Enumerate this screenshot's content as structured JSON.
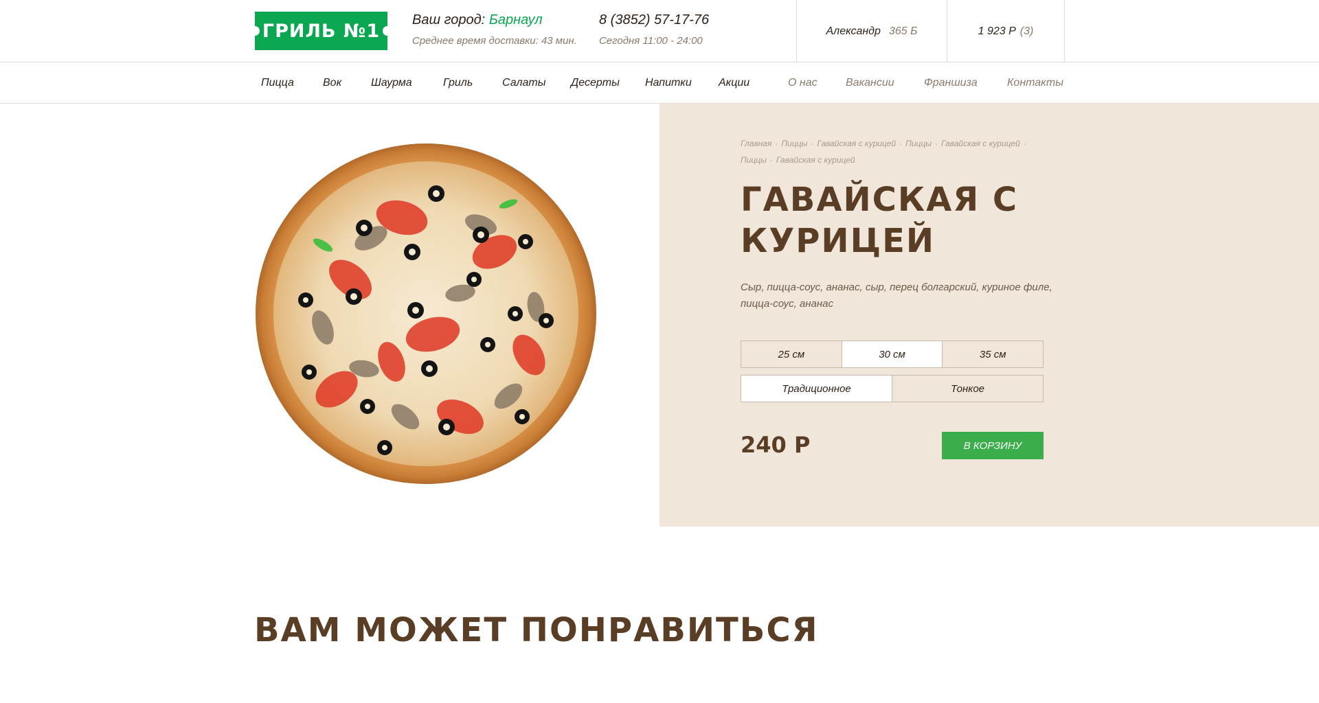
{
  "header": {
    "logo_text": "ГРИЛЬ №1",
    "city_label": "Ваш город:",
    "city_name": "Барнаул",
    "delivery_text": "Среднее время доставки: 43 мин.",
    "phone": "8 (3852) 57-17-76",
    "hours": "Сегодня 11:00 - 24:00",
    "user_name": "Александр",
    "user_bonus": "365 Б",
    "cart_sum": "1 923 Р",
    "cart_count": "(3)"
  },
  "nav": {
    "items": [
      {
        "label": "Пицца"
      },
      {
        "label": "Вок"
      },
      {
        "label": "Шаурма"
      },
      {
        "label": "Гриль"
      },
      {
        "label": "Салаты"
      },
      {
        "label": "Десерты"
      },
      {
        "label": "Напитки"
      },
      {
        "label": "Акции"
      },
      {
        "label": "О нас"
      },
      {
        "label": "Вакансии"
      },
      {
        "label": "Франшиза"
      },
      {
        "label": "Контакты"
      }
    ]
  },
  "breadcrumb": {
    "separator": "·",
    "items": [
      "Главная",
      "Пиццы",
      "Гавайская с курицей",
      "Пиццы",
      "Гавайская с курицей",
      "Пиццы",
      "Гавайская с курицей"
    ]
  },
  "product": {
    "title": "Гавайская с курицей",
    "description": "Сыр, пицца-соус, ананас, сыр, перец болгарский, куриное филе, пицца-соус, ананас",
    "sizes": [
      "25 см",
      "30 см",
      "35 см"
    ],
    "selected_size": "30 см",
    "dough": [
      "Традиционное",
      "Тонкое"
    ],
    "selected_dough": "Традиционное",
    "price": "240 Р",
    "cart_button": "В КОРЗИНУ"
  },
  "recommend": {
    "title": "Вам может понравиться"
  },
  "colors": {
    "brand_green": "#0aa650",
    "button_green": "#3aae4a",
    "title_brown": "#5a3d25",
    "panel_beige": "#f1e6da"
  }
}
